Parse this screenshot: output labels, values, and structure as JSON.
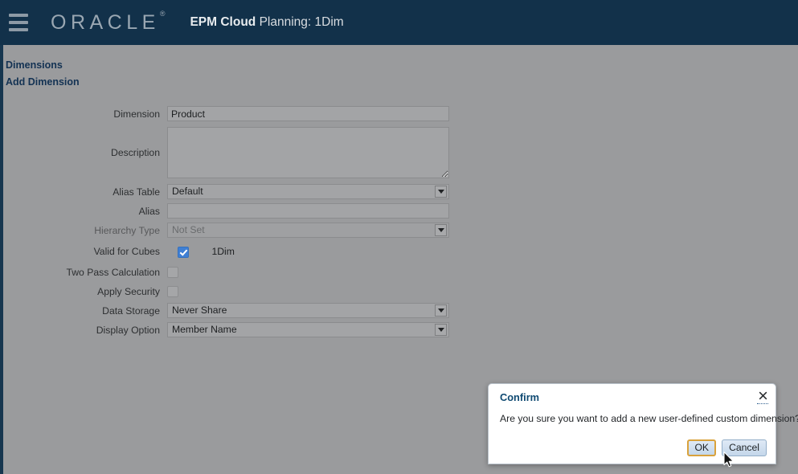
{
  "header": {
    "menu_icon": "hamburger-menu-icon",
    "brand": "ORACLE",
    "brand_trademark": "®",
    "app_name_bold": "EPM Cloud",
    "app_name_rest": " Planning: 1Dim"
  },
  "breadcrumb": {
    "items": [
      {
        "label": "Dimensions"
      },
      {
        "label": "Add Dimension"
      }
    ]
  },
  "form": {
    "dimension": {
      "label": "Dimension",
      "value": "Product",
      "placeholder": ""
    },
    "description": {
      "label": "Description",
      "value": "",
      "placeholder": ""
    },
    "alias_table": {
      "label": "Alias Table",
      "value": "Default",
      "options": [
        "Default"
      ]
    },
    "alias": {
      "label": "Alias",
      "value": "",
      "placeholder": ""
    },
    "hierarchy_type": {
      "label": "Hierarchy Type",
      "value": "Not Set",
      "options": [
        "Not Set"
      ],
      "disabled": true
    },
    "valid_for_cubes": {
      "label": "Valid for Cubes",
      "checked": true,
      "cube_name": "1Dim"
    },
    "two_pass_calculation": {
      "label": "Two Pass Calculation",
      "checked": false
    },
    "apply_security": {
      "label": "Apply Security",
      "checked": false
    },
    "data_storage": {
      "label": "Data Storage",
      "value": "Never Share",
      "options": [
        "Never Share"
      ]
    },
    "display_option": {
      "label": "Display Option",
      "value": "Member Name",
      "options": [
        "Member Name"
      ]
    }
  },
  "confirm_dialog": {
    "title": "Confirm",
    "close_icon": "close-x-icon",
    "message": "Are you sure you want to add a new user-defined custom dimension?",
    "ok_label": "OK",
    "cancel_label": "Cancel"
  },
  "colors": {
    "header_navy": "#12314a",
    "page_gray": "#9a9b9d",
    "breadcrumb_link": "#133253",
    "checkbox_blue": "#3f7fd4",
    "dialog_title": "#0f4a72",
    "focus_orange": "#d9a23c"
  }
}
